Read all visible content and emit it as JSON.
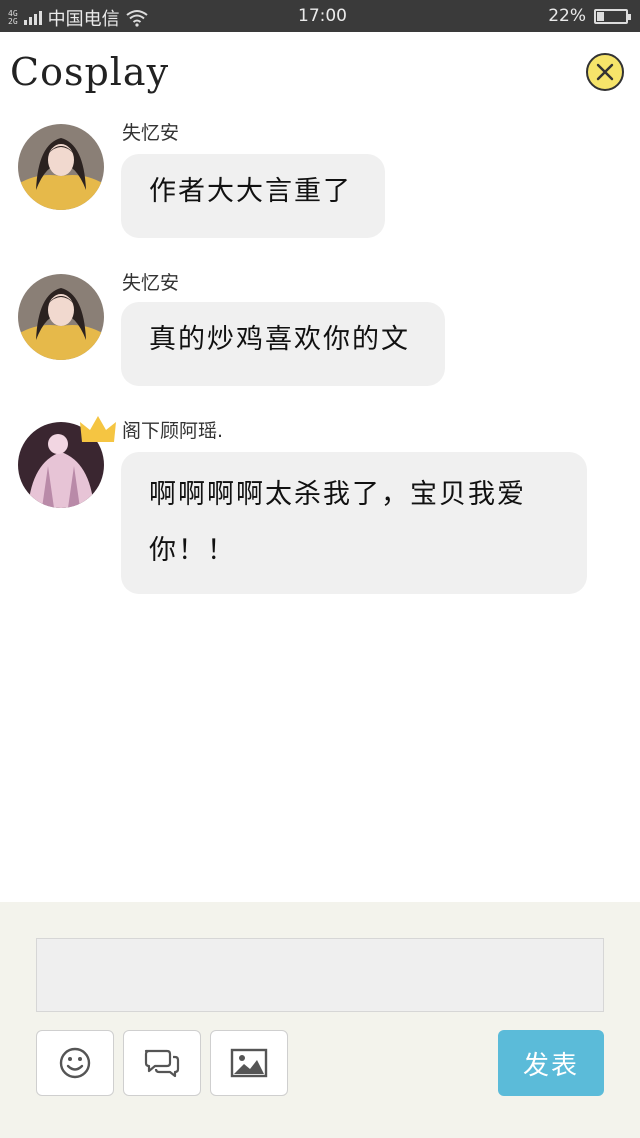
{
  "status_bar": {
    "network_top": "4G",
    "network_bottom": "2G",
    "carrier": "中国电信",
    "time": "17:00",
    "battery_text": "22%",
    "battery_level": 0.22
  },
  "header": {
    "logo": "Cosplay",
    "close_icon": "close-icon"
  },
  "messages": [
    {
      "name": "失忆安",
      "text": "作者大大言重了"
    },
    {
      "name": "失忆安",
      "text": "真的炒鸡喜欢你的文"
    },
    {
      "name": "阁下顾阿瑶.",
      "text": "啊啊啊啊太杀我了，宝贝我爱你！！"
    }
  ],
  "composer": {
    "input_value": "",
    "emoji_icon": "smiley-icon",
    "chat_icon": "chat-bubbles-icon",
    "image_icon": "image-icon",
    "send_label": "发表"
  },
  "colors": {
    "status_bar": "#3a3a3a",
    "bubble": "#f0f0f0",
    "close_button": "#f6e46a",
    "send_button": "#5bbbd9",
    "composer_bg": "#f3f3ec"
  }
}
